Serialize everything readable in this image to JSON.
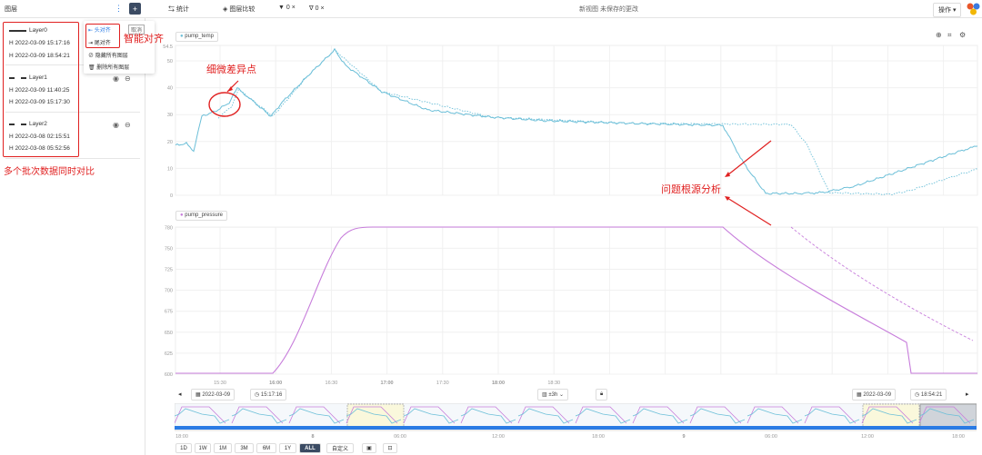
{
  "topbar": {
    "panel_title": "图层",
    "add_label": "+",
    "tabs": [
      "统计",
      "图层比较"
    ],
    "filter1_count": "0",
    "filter2_count": "0",
    "status": "新视图 未保存的更改",
    "action_label": "操作"
  },
  "layers": [
    {
      "name": "Layer0",
      "start": "2022-03-09 15:17:16",
      "end": "2022-03-09 18:54:21",
      "style": "solid"
    },
    {
      "name": "Layer1",
      "start": "2022-03-09 11:40:25",
      "end": "2022-03-09 15:17:30",
      "style": "dashed"
    },
    {
      "name": "Layer2",
      "start": "2022-03-08 02:15:51",
      "end": "2022-03-08 05:52:56",
      "style": "dashed"
    }
  ],
  "layer_date_prefix": "H",
  "menu": {
    "items": [
      "头对齐",
      "尾对齐",
      "隐藏所有图层",
      "删除所有图层"
    ],
    "tag": "取消"
  },
  "annotations": {
    "smart_align": "智能对齐",
    "multi_batch": "多个批次数据同时对比",
    "subtle_diff": "细微差异点",
    "root_cause": "问题根源分析"
  },
  "chart1": {
    "legend": "pump_temp",
    "color": "#6cbfd8",
    "y_ticks": [
      "0",
      "10",
      "20",
      "30",
      "40",
      "50"
    ],
    "top_label": "54.5"
  },
  "chart2": {
    "legend": "pump_pressure",
    "color": "#c77ddb",
    "y_ticks": [
      "600",
      "625",
      "650",
      "675",
      "700",
      "725",
      "750",
      "780"
    ]
  },
  "x_axis": {
    "ticks": [
      "15:30",
      "16:00",
      "16:30",
      "17:00",
      "17:30",
      "18:00",
      "18:30"
    ],
    "bold": [
      false,
      true,
      false,
      true,
      false,
      true,
      false
    ]
  },
  "time_controls": {
    "start_date": "2022-03-09",
    "start_time": "15:17:16",
    "zoom": "±3h",
    "end_date": "2022-03-09",
    "end_time": "18:54:21"
  },
  "navigator": {
    "ticks": [
      "18:00",
      "8",
      "06:00",
      "12:00",
      "18:00",
      "9",
      "06:00",
      "12:00",
      "18:00"
    ],
    "bold": [
      false,
      true,
      false,
      false,
      false,
      true,
      false,
      false,
      false
    ]
  },
  "range_buttons": [
    "1D",
    "1W",
    "1M",
    "3M",
    "6M",
    "1Y",
    "ALL",
    "自定义"
  ],
  "range_active": "ALL"
}
